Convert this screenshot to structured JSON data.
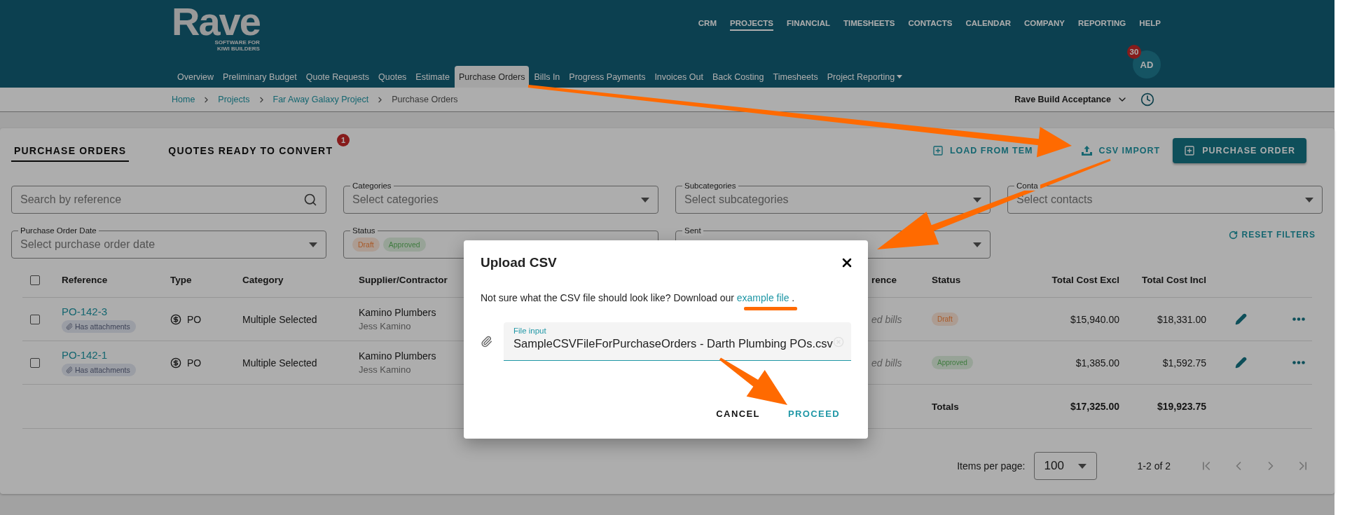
{
  "brand": {
    "name": "Rave",
    "tagline": [
      "SOFTWARE FOR",
      "KIWI BUILDERS"
    ]
  },
  "top_nav": [
    {
      "label": "CRM",
      "selected": false
    },
    {
      "label": "PROJECTS",
      "selected": true
    },
    {
      "label": "FINANCIAL",
      "selected": false
    },
    {
      "label": "TIMESHEETS",
      "selected": false
    },
    {
      "label": "CONTACTS",
      "selected": false
    },
    {
      "label": "CALENDAR",
      "selected": false
    },
    {
      "label": "COMPANY",
      "selected": false
    },
    {
      "label": "REPORTING",
      "selected": false
    },
    {
      "label": "HELP",
      "selected": false
    }
  ],
  "project_tabs": [
    {
      "label": "Overview",
      "selected": false,
      "dropdown": false
    },
    {
      "label": "Preliminary Budget",
      "selected": false,
      "dropdown": false
    },
    {
      "label": "Quote Requests",
      "selected": false,
      "dropdown": false
    },
    {
      "label": "Quotes",
      "selected": false,
      "dropdown": false
    },
    {
      "label": "Estimate",
      "selected": false,
      "dropdown": false
    },
    {
      "label": "Purchase Orders",
      "selected": true,
      "dropdown": false
    },
    {
      "label": "Bills In",
      "selected": false,
      "dropdown": false
    },
    {
      "label": "Progress Payments",
      "selected": false,
      "dropdown": false
    },
    {
      "label": "Invoices Out",
      "selected": false,
      "dropdown": false
    },
    {
      "label": "Back Costing",
      "selected": false,
      "dropdown": false
    },
    {
      "label": "Timesheets",
      "selected": false,
      "dropdown": false
    },
    {
      "label": "Project Reporting",
      "selected": false,
      "dropdown": true
    }
  ],
  "user": {
    "initials": "AD",
    "badge": "30"
  },
  "breadcrumb": [
    {
      "label": "Home",
      "current": false
    },
    {
      "label": "Projects",
      "current": false
    },
    {
      "label": "Far Away Galaxy Project",
      "current": false
    },
    {
      "label": "Purchase Orders",
      "current": true
    }
  ],
  "company_selector": "Rave Build Acceptance",
  "page_tabs": [
    {
      "label": "PURCHASE ORDERS",
      "selected": true
    },
    {
      "label": "QUOTES READY TO CONVERT",
      "selected": false,
      "badge": "1"
    }
  ],
  "actions": [
    {
      "label": "LOAD FROM TEM",
      "kind": "template"
    },
    {
      "label": "CSV IMPORT",
      "kind": "import"
    },
    {
      "label": "PURCHASE ORDER",
      "kind": "primary"
    }
  ],
  "filters": [
    {
      "kind": "search",
      "placeholder": "Search by reference"
    },
    {
      "kind": "select",
      "label": "Categories",
      "placeholder": "Select categories"
    },
    {
      "kind": "select",
      "label": "Subcategories",
      "placeholder": "Select subcategories"
    },
    {
      "kind": "select",
      "label": "Conta",
      "placeholder": "Select contacts"
    },
    {
      "kind": "select",
      "label": "Purchase Order Date",
      "placeholder": "Select purchase order date"
    },
    {
      "kind": "chips",
      "label": "Status",
      "chips": [
        {
          "label": "Draft",
          "color": "#ac9c92"
        },
        {
          "label": "Approved",
          "color": "#97a397"
        }
      ]
    },
    {
      "kind": "select",
      "label": "Sent"
    },
    {
      "kind": "reset",
      "label": "RESET FILTERS"
    }
  ],
  "table": {
    "all_selected": false,
    "columns": [
      "Reference",
      "Type",
      "Category",
      "Supplier/Contractor",
      "rence",
      "Status",
      "Total Cost Excl",
      "Total Cost Incl"
    ],
    "rows": [
      {
        "selected": false,
        "reference": "PO-142-3",
        "attachment": "Has attachments",
        "type": "PO",
        "category": "Multiple Selected",
        "supplier": "Kamino Plumbers",
        "contact": "Jess Kamino",
        "column_5": "ed bills",
        "status": {
          "label": "Draft",
          "color": "#ac9c92"
        },
        "total_excl": "$15,940.00",
        "total_incl": "$18,331.00"
      },
      {
        "selected": false,
        "reference": "PO-142-1",
        "attachment": "Has attachments",
        "type": "PO",
        "category": "Multiple Selected",
        "supplier": "Kamino Plumbers",
        "contact": "Jess Kamino",
        "column_5": "ed bills",
        "status": {
          "label": "Approved",
          "color": "#97a397"
        },
        "total_excl": "$1,385.00",
        "total_incl": "$1,592.75"
      }
    ],
    "totals": {
      "label": "Totals",
      "excl": "$17,325.00",
      "incl": "$19,923.75"
    }
  },
  "pagination": {
    "label": "Items per page:",
    "page_size": "100",
    "range": "1-2 of 2",
    "nav": [
      {
        "kind": "first",
        "disabled": true
      },
      {
        "kind": "prev",
        "disabled": true
      },
      {
        "kind": "next",
        "disabled": true
      },
      {
        "kind": "last",
        "disabled": true
      }
    ]
  },
  "dialog": {
    "title": "Upload CSV",
    "text": "Not sure what the CSV file should look like? Download our",
    "link": "example file",
    "after_link": ".",
    "file_label": "File input",
    "file_value": "SampleCSVFileForPurchaseOrders - Darth Plumbing POs.csv",
    "buttons": [
      {
        "label": "CANCEL",
        "kind": "secondary"
      },
      {
        "label": "PROCEED",
        "kind": "primary"
      }
    ]
  }
}
